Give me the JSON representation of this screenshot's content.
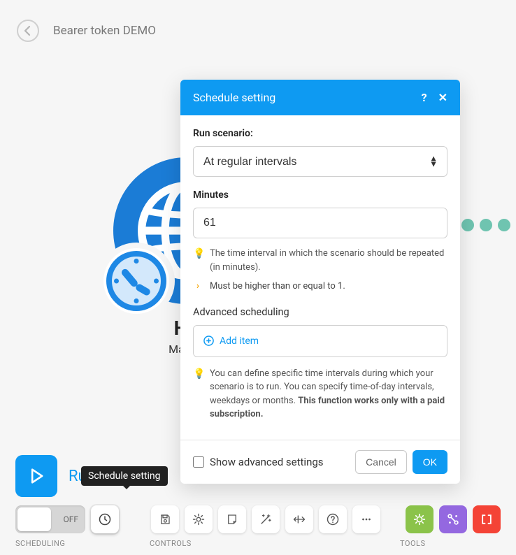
{
  "header": {
    "title": "Bearer token DEMO"
  },
  "node": {
    "title": "HT",
    "subtitle": "Make a"
  },
  "modal": {
    "title": "Schedule setting",
    "run_scenario_label": "Run scenario:",
    "run_scenario_value": "At regular intervals",
    "minutes_label": "Minutes",
    "minutes_value": "61",
    "minutes_hint": "The time interval in which the scenario should be repeated (in minutes).",
    "minutes_constraint": "Must be higher than or equal to 1.",
    "advanced_label": "Advanced scheduling",
    "add_item": "Add item",
    "advanced_hint_prefix": "You can define specific time intervals during which your scenario is to run. You can specify time-of-day intervals, weekdays or months. ",
    "advanced_hint_bold": "This function works only with a paid subscription.",
    "show_advanced": "Show advanced settings",
    "cancel": "Cancel",
    "ok": "OK"
  },
  "bottom": {
    "run_once": "Run once",
    "tooltip": "Schedule setting",
    "toggle": "OFF",
    "section_scheduling": "SCHEDULING",
    "section_controls": "CONTROLS",
    "section_tools": "TOOLS"
  }
}
